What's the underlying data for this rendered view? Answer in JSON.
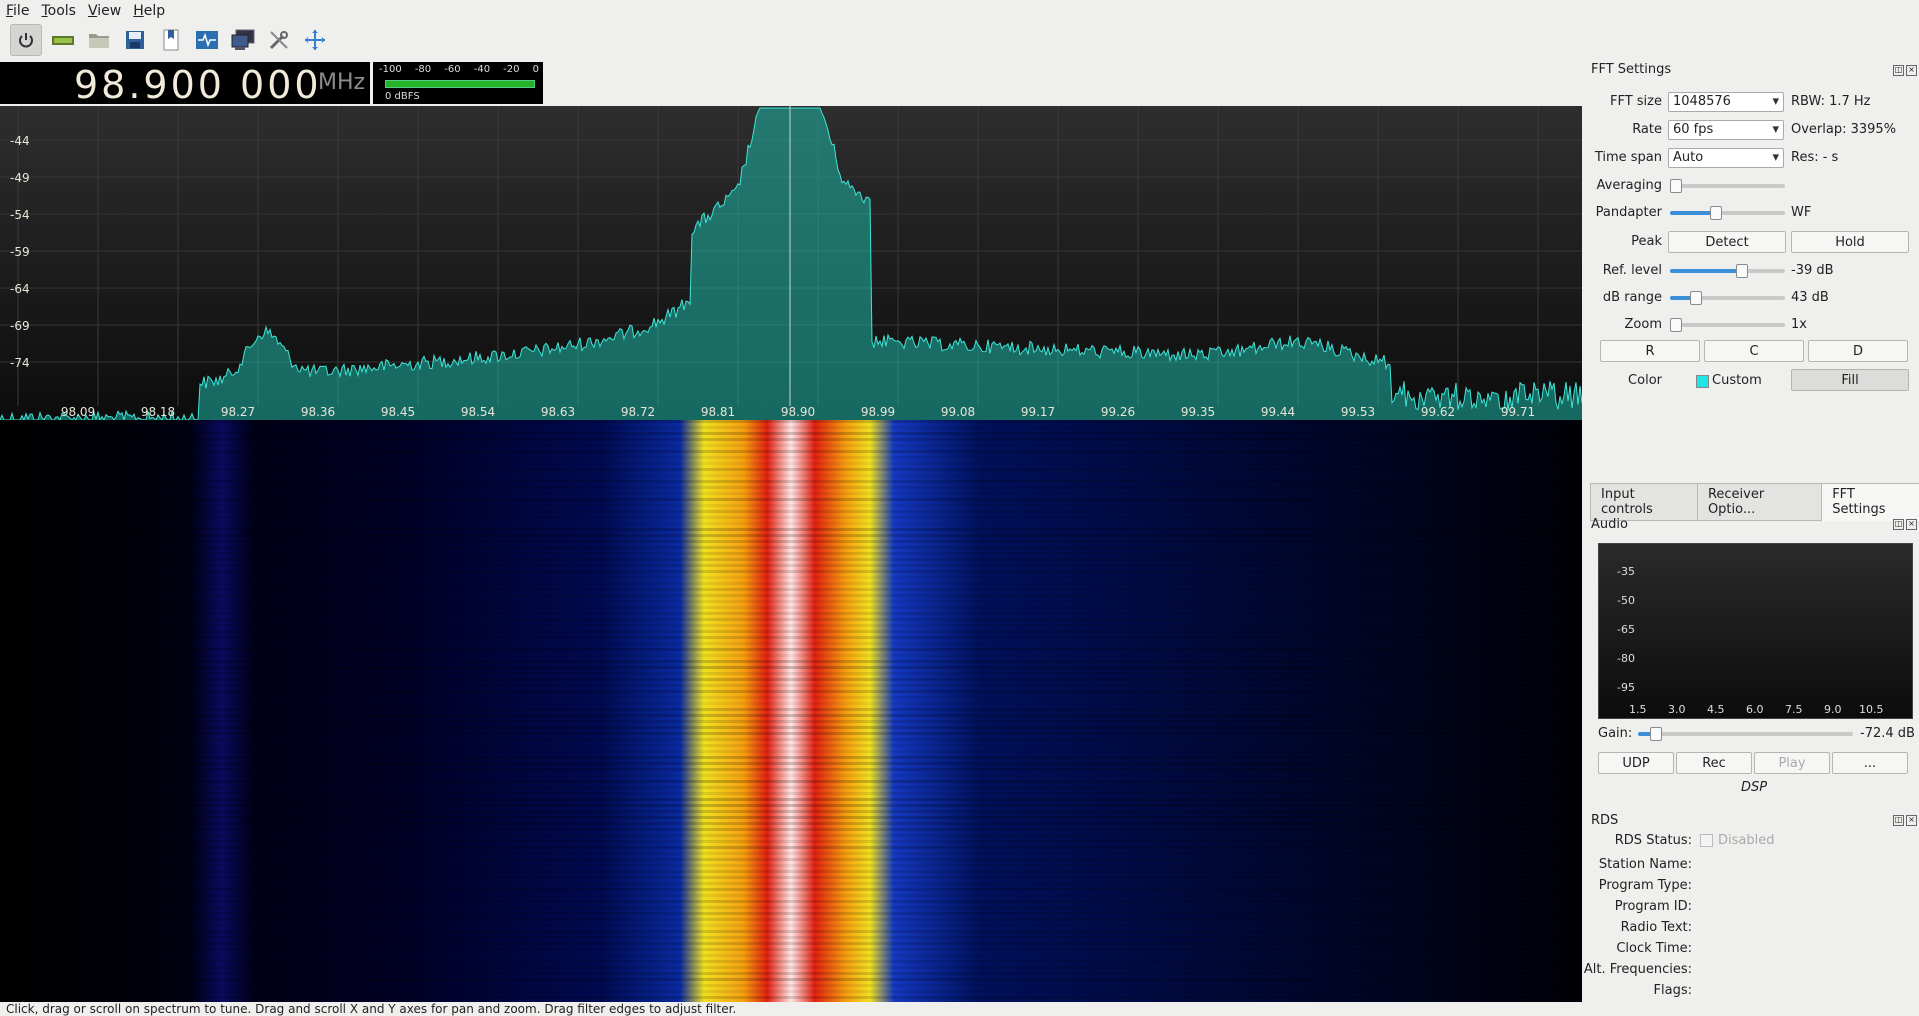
{
  "menu": [
    "File",
    "Tools",
    "View",
    "Help"
  ],
  "toolbar_icons": [
    "power-icon",
    "hardware-icon",
    "open-folder-icon",
    "save-icon",
    "bookmark-icon",
    "iq-tool-icon",
    "remote-control-icon",
    "settings-icon",
    "reset-view-icon"
  ],
  "frequency": {
    "value": "98.900 000",
    "unit": "MHz"
  },
  "smeter": {
    "ticks": [
      "-100",
      "-80",
      "-60",
      "-40",
      "-20",
      "0"
    ],
    "label": "0 dBFS"
  },
  "spectrum": {
    "y_labels": [
      "-44",
      "-49",
      "-54",
      "-59",
      "-64",
      "-69",
      "-74"
    ],
    "x_labels": [
      "98.09",
      "98.18",
      "98.27",
      "98.36",
      "98.45",
      "98.54",
      "98.63",
      "98.72",
      "98.81",
      "98.90",
      "98.99",
      "99.08",
      "99.17",
      "99.26",
      "99.35",
      "99.44",
      "99.53",
      "99.62",
      "99.71"
    ],
    "fill_color": "#1fb6a8",
    "line_color": "#3ee6d8"
  },
  "fft": {
    "title": "FFT Settings",
    "fft_size_label": "FFT size",
    "fft_size": "1048576",
    "rbw": "RBW: 1.7 Hz",
    "rate_label": "Rate",
    "rate": "60 fps",
    "overlap": "Overlap: 3395%",
    "timespan_label": "Time span",
    "timespan": "Auto",
    "res": "Res: - s",
    "averaging_label": "Averaging",
    "pandapter_label": "Pandapter",
    "wf": "WF",
    "peak_label": "Peak",
    "detect": "Detect",
    "hold": "Hold",
    "ref_label": "Ref. level",
    "ref_value": "-39 dB",
    "dbrange_label": "dB range",
    "dbrange_value": "43 dB",
    "zoom_label": "Zoom",
    "zoom_value": "1x",
    "r": "R",
    "c": "C",
    "d": "D",
    "color_label": "Color",
    "color_name": "Custom",
    "fill": "Fill",
    "swatch": "#1fe6e6"
  },
  "tabs": [
    "Input controls",
    "Receiver Optio...",
    "FFT Settings"
  ],
  "audio": {
    "title": "Audio",
    "y_labels": [
      "-35",
      "-50",
      "-65",
      "-80",
      "-95"
    ],
    "x_labels": [
      "1.5",
      "3.0",
      "4.5",
      "6.0",
      "7.5",
      "9.0",
      "10.5"
    ],
    "gain_label": "Gain:",
    "gain_value": "-72.4 dB",
    "udp": "UDP",
    "rec": "Rec",
    "play": "Play",
    "more": "...",
    "dsp": "DSP"
  },
  "rds": {
    "title": "RDS",
    "status_label": "RDS Status:",
    "status_value": "Disabled",
    "fields": [
      "Station Name:",
      "Program Type:",
      "Program ID:",
      "Radio Text:",
      "Clock Time:",
      "Alt. Frequencies:",
      "Flags:"
    ]
  },
  "status": "Click, drag or scroll on spectrum to tune. Drag and scroll X and Y axes for pan and zoom. Drag filter edges to adjust filter."
}
